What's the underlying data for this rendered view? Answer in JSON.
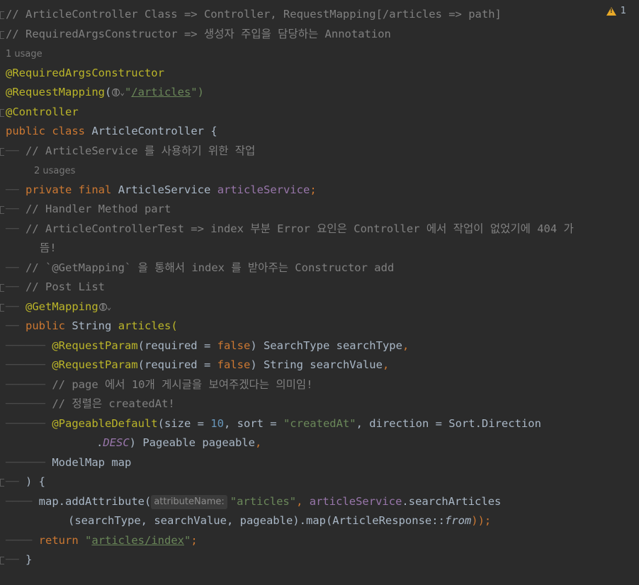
{
  "inspection": {
    "count": "1"
  },
  "lines": {
    "c1": "// ArticleController Class => Controller, RequestMapping[/articles => path]",
    "c2": "// RequiredArgsConstructor => 생성자 주입을 담당하는 Annotation",
    "usage1": "1 usage",
    "a_required": "@RequiredArgsConstructor",
    "a_reqmap": "@RequestMapping",
    "paren_open": "(",
    "reqmap_q1": "\"",
    "reqmap_url": "/articles",
    "reqmap_tail": "\")",
    "a_controller": "@Controller",
    "kw_public": "public",
    "kw_class": "class",
    "class_decl": "ArticleController {",
    "c3": "// ArticleService 를 사용하기 위한 작업",
    "usage2": "2 usages",
    "kw_private": "private",
    "kw_final": "final",
    "field_type": "ArticleService",
    "field_name": "articleService",
    "semi": ";",
    "c4": "// Handler Method part",
    "c5a": "// ArticleControllerTest => index 부분 Error 요인은 Controller 에서 작업이 없었기에 404 가",
    "c5b": "뜸!",
    "c6": "// `@GetMapping` 을 통해서 index 를 받아주는 Constructor add",
    "c7": "// Post List",
    "a_getmap": "@GetMapping",
    "method_ret": "String",
    "method_name": "articles(",
    "a_reqparam": "@RequestParam",
    "rp_open": "(required = ",
    "kw_false": "false",
    "rp1_tail": ") SearchType searchType",
    "comma": ",",
    "rp2_tail": ") String searchValue",
    "c8": "// page 에서 10개 게시글을 보여주겠다는 의미임!",
    "c9": "// 정렬은 createdAt!",
    "a_pageable": "@PageableDefault",
    "pd_size": "(size = ",
    "pd_size_val": "10",
    "pd_sort": ", sort = ",
    "pd_sort_val": "\"createdAt\"",
    "pd_dir": ", direction = Sort.Direction",
    "pd_dot": ".",
    "pd_desc": "DESC",
    "pd_tail": ") Pageable pageable",
    "modelmap": "ModelMap map",
    "close_sig": ") {",
    "map_call": "map.addAttribute(",
    "param_hint": "attributeName:",
    "attr_str": "\"articles\"",
    "attr_comma": ", ",
    "svc_field": "articleService",
    "svc_call": ".searchArticles",
    "map_cont_a": "(searchType, searchValue, pageable).map(ArticleResponse::",
    "map_from": "from",
    "map_cont_b": "));",
    "kw_return": "return",
    "ret_q1": "\"",
    "ret_url": "articles/index",
    "ret_q2": "\"",
    "close_brace": "}"
  }
}
